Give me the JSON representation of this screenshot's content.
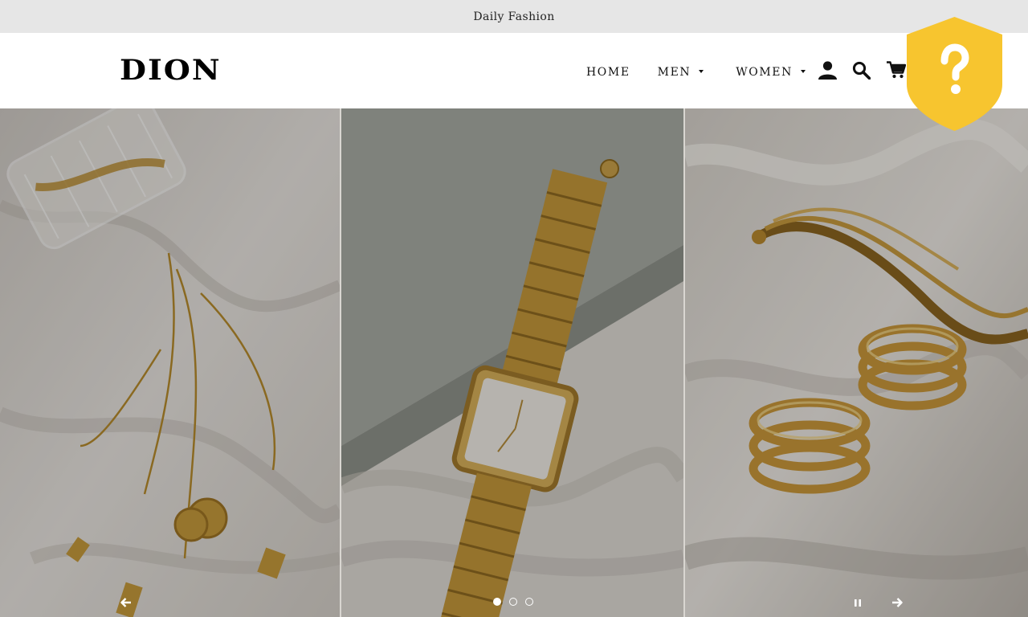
{
  "announcement": {
    "text": "Daily Fashion"
  },
  "header": {
    "logo": "DION",
    "nav": [
      {
        "label": "HOME",
        "has_dropdown": false
      },
      {
        "label": "MEN",
        "has_dropdown": true
      },
      {
        "label": "WOMEN",
        "has_dropdown": true
      }
    ],
    "icons": [
      "account-icon",
      "search-icon",
      "cart-icon"
    ]
  },
  "slideshow": {
    "slides_count": 3,
    "active_slide": 1,
    "controls": {
      "prev": "arrow-left-icon",
      "next": "arrow-right-icon",
      "pause": "pause-icon"
    }
  },
  "badge": {
    "icon": "shield-question-icon",
    "color": "#f7c52f"
  },
  "colors": {
    "announcement_bg": "#e6e6e6",
    "header_bg": "#ffffff",
    "text": "#111111"
  }
}
